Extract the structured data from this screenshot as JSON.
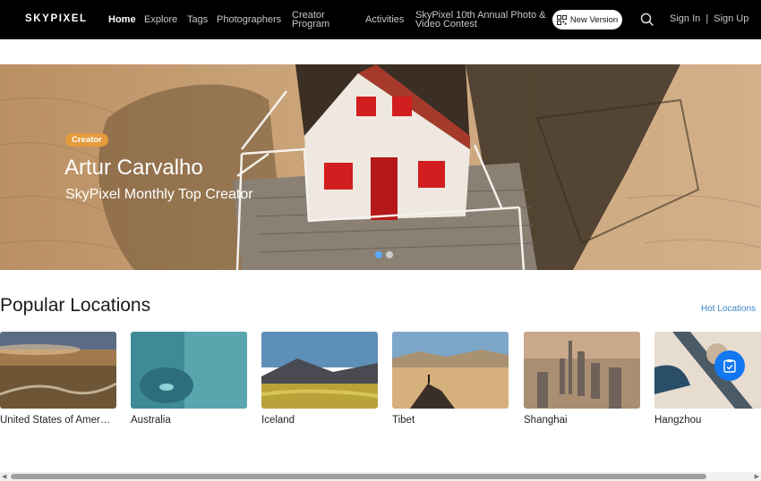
{
  "nav": {
    "logo": "SKYPIXEL",
    "items": [
      {
        "label": "Home",
        "active": true
      },
      {
        "label": "Explore"
      },
      {
        "label": "Tags"
      },
      {
        "label": "Photographers"
      },
      {
        "label": "Creator Program"
      },
      {
        "label": "Activities"
      },
      {
        "label": "SkyPixel 10th Annual Photo & Video Contest"
      }
    ],
    "new_version": "New Version",
    "sign_in": "Sign In",
    "separator": "|",
    "sign_up": "Sign Up"
  },
  "hero": {
    "badge": "Creator",
    "name": "Artur Carvalho",
    "subtitle": "SkyPixel Monthly Top Creator",
    "slides": 2,
    "active_slide": 0
  },
  "locations": {
    "title": "Popular Locations",
    "more_link": "Hot Locations",
    "items": [
      {
        "label": "United States of Amer…"
      },
      {
        "label": "Australia"
      },
      {
        "label": "Iceland"
      },
      {
        "label": "Tibet"
      },
      {
        "label": "Shanghai"
      },
      {
        "label": "Hangzhou"
      }
    ]
  },
  "icons": {
    "search": "search-icon",
    "qr": "qr-icon",
    "fab": "clipboard-icon"
  },
  "colors": {
    "nav_bg": "#000000",
    "badge": "#e49b3b",
    "link": "#3c84c6",
    "fab": "#1277f0"
  }
}
